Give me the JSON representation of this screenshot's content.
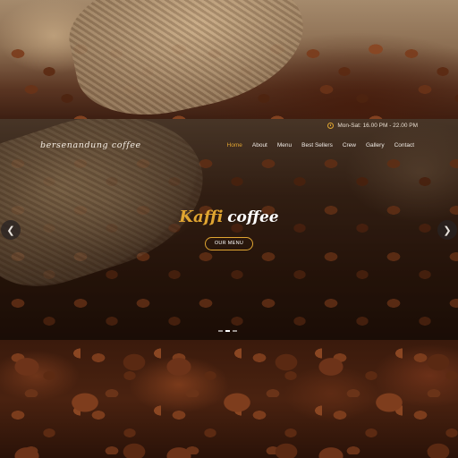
{
  "header": {
    "logo": "bersenandung coffee",
    "hours": "Mon-Sat: 16.00 PM - 22.00 PM"
  },
  "nav": {
    "items": [
      "Home",
      "About",
      "Menu",
      "Best Sellers",
      "Crew",
      "Gallery",
      "Contact"
    ],
    "active": "Home"
  },
  "hero": {
    "title_script": "Kaffi",
    "title_plain": "coffee",
    "cta_label": "OUR MENU"
  },
  "slider": {
    "prev_icon": "chevron-left-icon",
    "next_icon": "chevron-right-icon",
    "slide_count": 3,
    "active_slide": 2
  },
  "colors": {
    "accent": "#e0a531",
    "text": "#f1ece6"
  }
}
